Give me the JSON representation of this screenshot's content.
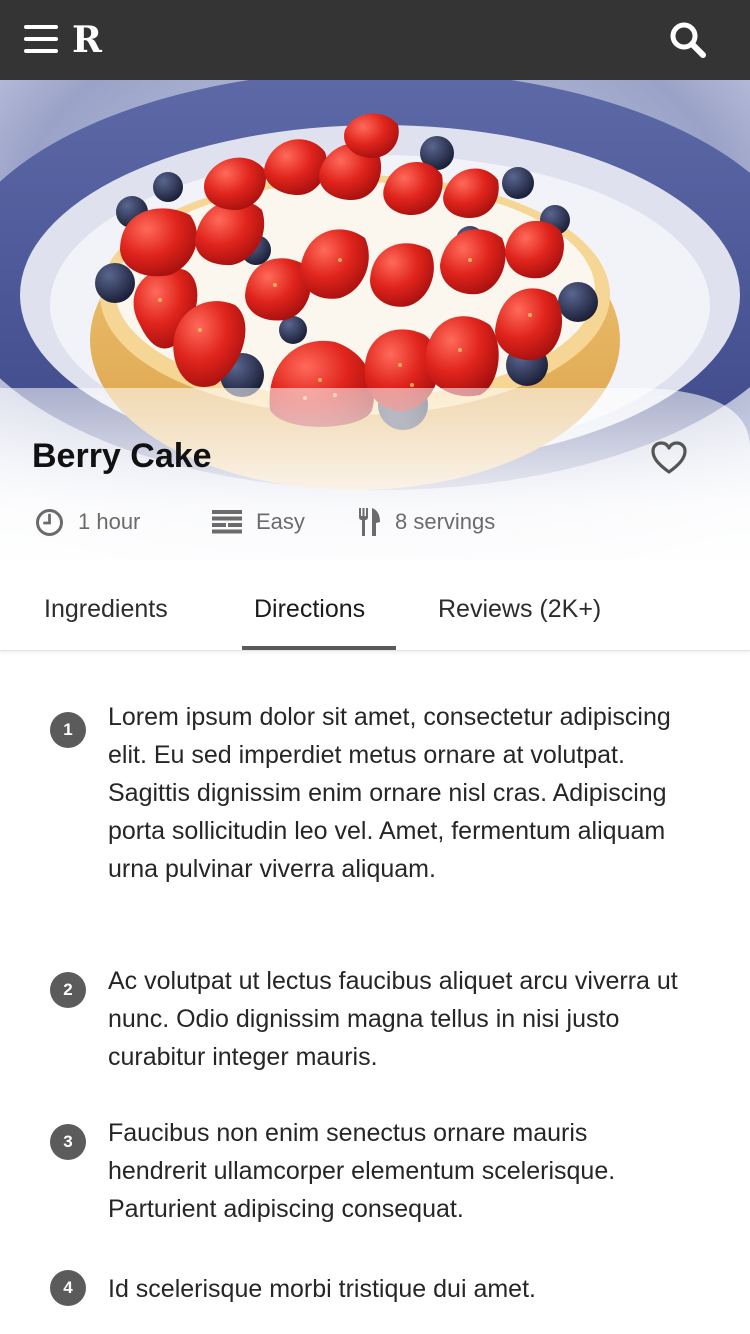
{
  "header": {
    "logo": "R",
    "menu_icon": "hamburger-menu-icon",
    "search_icon": "search-icon",
    "background": "#343434"
  },
  "hero": {
    "image": "berry-cake-photo"
  },
  "recipe": {
    "title": "Berry Cake",
    "favorite_icon": "heart-outline-icon",
    "meta": {
      "time": "1 hour",
      "difficulty": "Easy",
      "servings": "8 servings"
    }
  },
  "tabs": [
    {
      "label": "Ingredients",
      "active": false
    },
    {
      "label": "Directions",
      "active": true
    },
    {
      "label": "Reviews (2K+)",
      "active": false
    }
  ],
  "directions": [
    {
      "number": "1",
      "text": "Lorem ipsum dolor sit amet, consectetur adipiscing elit. Eu sed imperdiet metus ornare at volutpat. Sagittis dignissim enim ornare nisl cras. Adipiscing porta sollicitudin leo vel. Amet, fermentum aliquam urna pulvinar viverra aliquam."
    },
    {
      "number": "2",
      "text": "Ac volutpat ut lectus faucibus aliquet arcu viverra ut nunc. Odio dignissim magna tellus in nisi justo curabitur integer mauris."
    },
    {
      "number": "3",
      "text": "Faucibus non enim senectus ornare mauris hendrerit ullamcorper elementum scelerisque. Parturient adipiscing consequat."
    },
    {
      "number": "4",
      "text": "Id scelerisque morbi tristique dui amet."
    }
  ]
}
